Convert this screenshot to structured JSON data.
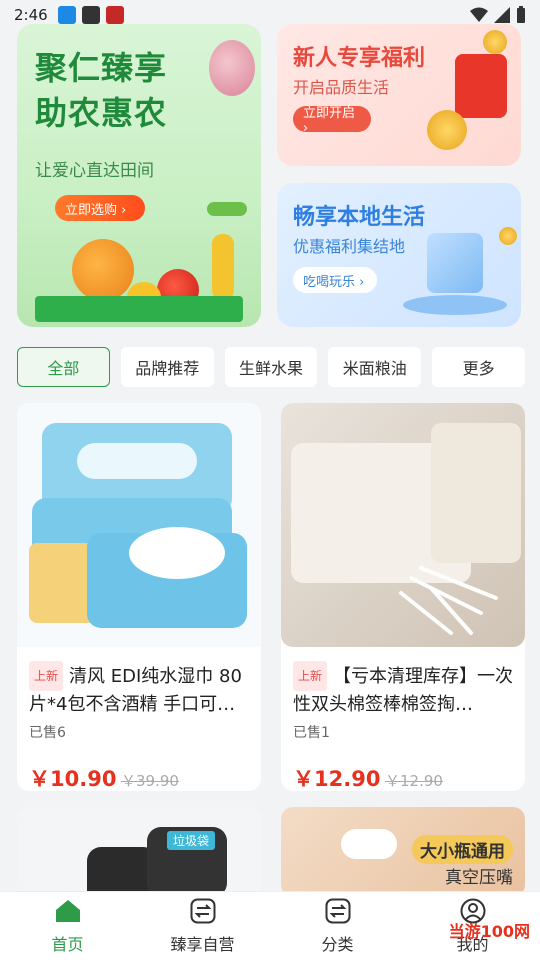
{
  "status_bar": {
    "time": "2:46"
  },
  "banners": {
    "main": {
      "title_line1": "聚仁臻享",
      "title_line2": "助农惠农",
      "subtitle": "让爱心直达田间",
      "button": "立即选购 ›"
    },
    "top_right": {
      "title": "新人专享福利",
      "subtitle": "开启品质生活",
      "button": "立即开启 ›"
    },
    "bottom_right": {
      "title": "畅享本地生活",
      "subtitle": "优惠福利集结地",
      "button": "吃喝玩乐 ›"
    }
  },
  "tabs": [
    "全部",
    "品牌推荐",
    "生鲜水果",
    "米面粮油",
    "更多"
  ],
  "products": [
    {
      "tag": "上新",
      "name": "清风 EDI纯水湿巾 80片*4包不含酒精 手口可…",
      "sold": "已售6",
      "price": "￥10.90",
      "orig_price": "￥39.90"
    },
    {
      "tag": "上新",
      "name": "【亏本清理库存】一次性双头棉签棒棉签掏…",
      "sold": "已售1",
      "price": "￥12.90",
      "orig_price": "￥12.90"
    }
  ],
  "product_partial": {
    "pump_label": "大小瓶通用",
    "pump_sub": "真空压嘴",
    "bags_label": "垃圾袋"
  },
  "nav": [
    "首页",
    "臻享自营",
    "分类",
    "我的"
  ],
  "watermark": "当游100网",
  "colors": {
    "brand_green": "#2d9b48",
    "price_red": "#e8301f"
  }
}
